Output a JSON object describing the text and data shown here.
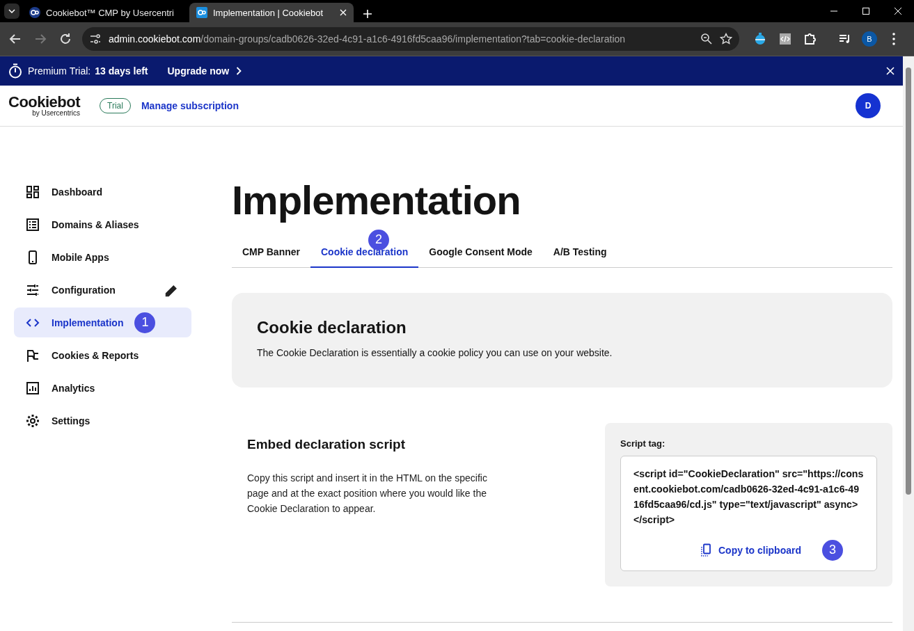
{
  "browser": {
    "tabs": [
      {
        "title": "Cookiebot™ CMP by Usercentri",
        "selected": false
      },
      {
        "title": "Implementation | Cookiebot",
        "selected": true
      }
    ],
    "url_host": "admin.cookiebot.com",
    "url_path": "/domain-groups/cadb0626-32ed-4c91-a1c6-4916fd5caa96/implementation?tab=cookie-declaration",
    "profile": "B"
  },
  "banner": {
    "label": "Premium Trial:",
    "days": "13 days left",
    "action": "Upgrade now"
  },
  "header": {
    "logo": "Cookiebot",
    "logo_sub": "by Usercentrics",
    "badge": "Trial",
    "link": "Manage subscription",
    "avatar": "D"
  },
  "sidebar": {
    "items": [
      {
        "label": "Dashboard",
        "selected": false,
        "editable": false
      },
      {
        "label": "Domains & Aliases",
        "selected": false,
        "editable": false
      },
      {
        "label": "Mobile Apps",
        "selected": false,
        "editable": false
      },
      {
        "label": "Configuration",
        "selected": false,
        "editable": true
      },
      {
        "label": "Implementation",
        "selected": true,
        "editable": false,
        "step": "1"
      },
      {
        "label": "Cookies & Reports",
        "selected": false,
        "editable": false
      },
      {
        "label": "Analytics",
        "selected": false,
        "editable": false
      },
      {
        "label": "Settings",
        "selected": false,
        "editable": false
      }
    ]
  },
  "page": {
    "title": "Implementation",
    "tabs": [
      {
        "label": "CMP Banner",
        "selected": false
      },
      {
        "label": "Cookie declaration",
        "selected": true,
        "step": "2"
      },
      {
        "label": "Google Consent Mode",
        "selected": false
      },
      {
        "label": "A/B Testing",
        "selected": false
      }
    ],
    "intro": {
      "title": "Cookie declaration",
      "text": "The Cookie Declaration is essentially a cookie policy you can use on your website."
    },
    "embed": {
      "title": "Embed declaration script",
      "text": "Copy this script and insert it in the HTML on the specific page and at the exact position where you would like the Cookie Declaration to appear.",
      "script_label": "Script tag:",
      "script": "<script id=\"CookieDeclaration\" src=\"https://consent.cookiebot.com/cadb0626-32ed-4c91-a1c6-4916fd5caa96/cd.js\" type=\"text/javascript\" async></script>",
      "copy": "Copy to clipboard",
      "step": "3"
    }
  }
}
